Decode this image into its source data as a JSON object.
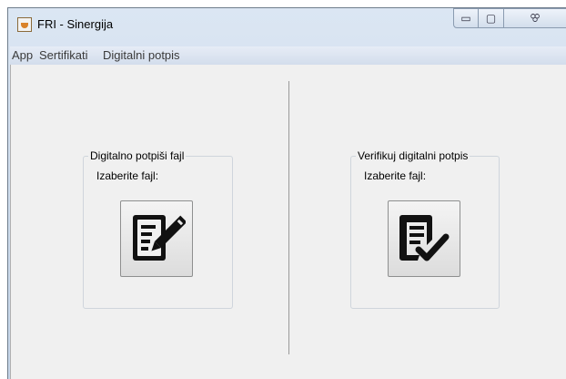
{
  "window": {
    "title": "FRI - Sinergija"
  },
  "window_controls": {
    "minimize": "▭",
    "maximize": "▢",
    "close": "ꕢ"
  },
  "menu": {
    "items": [
      "App",
      "Sertifikati",
      "Digitalni potpis"
    ]
  },
  "sign_panel": {
    "legend": "Digitalno potpiši fajl",
    "label": "Izaberite fajl:",
    "button_icon": "document-pen-icon"
  },
  "verify_panel": {
    "legend": "Verifikuj digitalni potpis",
    "label": "Izaberite fajl:",
    "button_icon": "document-check-icon"
  }
}
